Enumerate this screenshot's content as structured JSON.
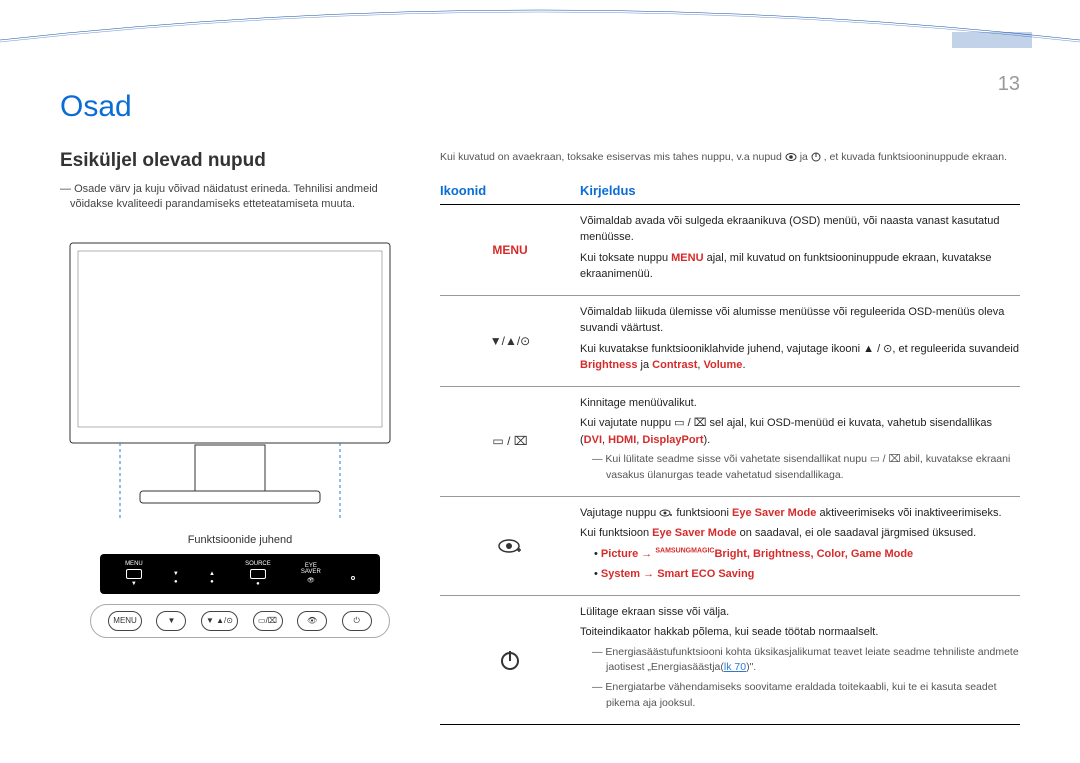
{
  "chapter_title": "Osad",
  "section_title": "Esiküljel olevad nupud",
  "intro_note": "Osade värv ja kuju võivad näidatust erineda. Tehnilisi andmeid võidakse kvaliteedi parandamiseks etteteatamiseta muuta.",
  "func_guide_label": "Funktsioonide juhend",
  "panel_labels": {
    "menu": "MENU",
    "source": "SOURCE",
    "eyesaver": "EYE\nSAVER"
  },
  "row2": {
    "menu": "MENU",
    "updown": "▼  ▲/⊙",
    "srcsel": "▭/⌧",
    "eye": "👁",
    "power": "⏻"
  },
  "top_note_a": "Kui kuvatud on avaekraan, toksake esiservas mis tahes nuppu, v.a nupud ",
  "top_note_b": " ja ",
  "top_note_c": ", et kuvada funktsiooninuppude ekraan.",
  "table_head": {
    "col1": "Ikoonid",
    "col2": "Kirjeldus"
  },
  "rows": {
    "r1": {
      "icon": "MENU",
      "p1": "Võimaldab avada või sulgeda ekraanikuva (OSD) menüü, või naasta vanast kasutatud menüüsse.",
      "p2a": "Kui toksate nuppu ",
      "p2b": " ajal, mil kuvatud on funktsiooninuppude ekraan, kuvatakse ekraanimenüü.",
      "p2hl": "MENU"
    },
    "r2": {
      "icon": "▼/▲/⊙",
      "p1": "Võimaldab liikuda ülemisse või alumisse menüüsse või reguleerida OSD-menüüs oleva suvandi väärtust.",
      "p2a": "Kui kuvatakse funktsiooniklahvide juhend, vajutage ikooni ▲ / ⊙, et reguleerida suvandeid ",
      "p2hl_a": "Brightness",
      "p2mid": " ja ",
      "p2hl_b": "Contrast",
      "p2sep": ", ",
      "p2hl_c": "Volume",
      "p2end": "."
    },
    "r3": {
      "icon": "▭ / ⌧",
      "p1": "Kinnitage menüüvalikut.",
      "p2a": "Kui vajutate nuppu ▭ / ⌧ sel ajal, kui OSD-menüüd ei kuvata, vahetub sisendallikas (",
      "p2hl_a": "DVI",
      "p2sep": ", ",
      "p2hl_b": "HDMI",
      "p2sep2": ", ",
      "p2hl_c": "DisplayPort",
      "p2end": ").",
      "sub": "Kui lülitate seadme sisse või vahetate sisendallikat nupu ▭ / ⌧ abil, kuvatakse ekraani vasakus ülanurgas teade vahetatud sisendallikaga."
    },
    "r4": {
      "p1a": "Vajutage nuppu ",
      "p1b": " funktsiooni ",
      "p1hl": "Eye Saver Mode",
      "p1c": " aktiveerimiseks või inaktiveerimiseks.",
      "p2a": "Kui funktsioon ",
      "p2hl": "Eye Saver Mode",
      "p2b": " on saadaval, ei ole saadaval järgmised üksused.",
      "b1a": "Picture",
      "b1arrow": " → ",
      "b1magic": "MAGIC",
      "b1samsung": "SAMSUNG",
      "b1b": "Bright",
      "b1sep": ", ",
      "b1c": "Brightness",
      "b1d": "Color",
      "b1e": "Game Mode",
      "b2a": "System",
      "b2arrow": " → ",
      "b2b": "Smart ECO Saving"
    },
    "r5": {
      "p1": "Lülitage ekraan sisse või välja.",
      "p2": "Toiteindikaator hakkab põlema, kui seade töötab normaalselt.",
      "sub1a": "Energiasäästufunktsiooni kohta üksikasjalikumat teavet leiate seadme tehniliste andmete jaotisest „Energiasäästja(",
      "sub1lnk": "lk 70",
      "sub1b": ")\".",
      "sub2": "Energiatarbe vähendamiseks soovitame eraldada toitekaabli, kui te ei kasuta seadet pikema aja jooksul."
    }
  },
  "page_number": "13"
}
